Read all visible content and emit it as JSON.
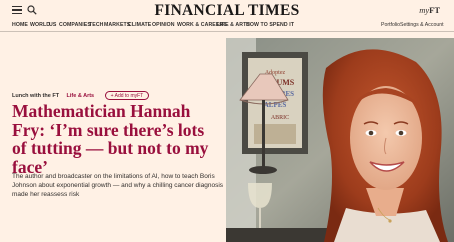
{
  "masthead": {
    "brand": "FINANCIAL TIMES",
    "myft_prefix": "my",
    "myft_suffix": "FT"
  },
  "nav": {
    "items": [
      "HOME",
      "WORLD",
      "US",
      "COMPANIES",
      "TECH",
      "MARKETS",
      "CLIMATE",
      "OPINION",
      "WORK & CAREERS",
      "LIFE & ARTS",
      "HOW TO SPEND IT"
    ],
    "right": [
      "Portfolio",
      "Settings & Account"
    ]
  },
  "article": {
    "kicker": "Lunch with the FT",
    "section": "Life & Arts",
    "add_myft": "+ Add to myFT",
    "headline": "Mathematician Hannah Fry: ‘I’m sure there’s lots of tutting — but not to my face’",
    "standfirst": "The author and broadcaster on the limitations of AI, how to teach Boris Johnson about exponential growth — and why a chilling cancer diagnosis made her reassess risk"
  },
  "hero_image": {
    "poster_lines": [
      "Adoptez",
      "PARFUMS",
      "BRUYÈRES",
      "ALPES",
      "ABRIC"
    ]
  },
  "colors": {
    "background": "#fff1e5",
    "claret": "#990f3d",
    "text": "#33302e"
  },
  "icons": [
    "hamburger-icon",
    "search-icon"
  ]
}
